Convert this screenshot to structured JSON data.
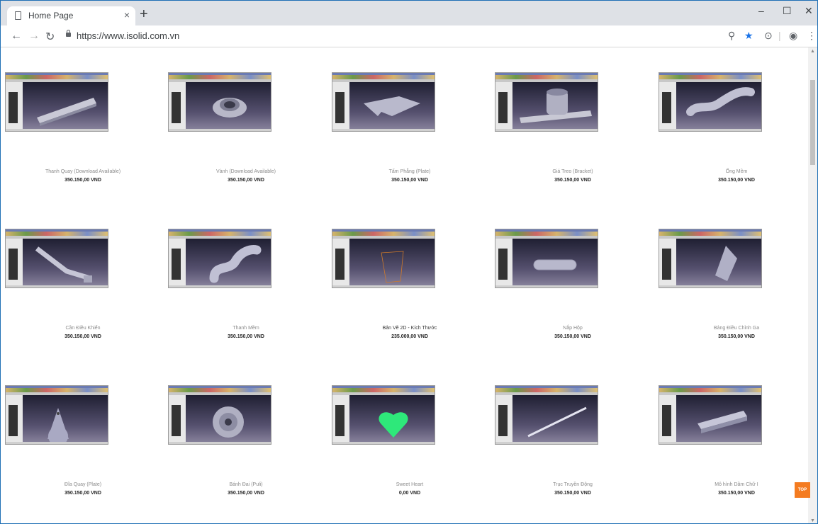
{
  "browser": {
    "tab_title": "Home Page",
    "tab_close": "×",
    "new_tab": "+",
    "url": "https://www.isolid.com.vn",
    "window_controls": [
      "–",
      "☐",
      "✕"
    ]
  },
  "toolbar_icons": [
    "zoom-icon",
    "bookmark-star-icon",
    "extension-icon",
    "profile-icon",
    "menu-icon"
  ],
  "colors": {
    "accent": "#1a73e8",
    "top_button": "#f47b20",
    "tab_strip": "#dee1e6"
  },
  "products": [
    {
      "name": "Thanh Quay (Download Available)",
      "price": "350.150,00 VND"
    },
    {
      "name": "Vành (Download Available)",
      "price": "350.150,00 VND"
    },
    {
      "name": "Tấm Phẳng (Plate)",
      "price": "350.150,00 VND"
    },
    {
      "name": "Giá Treo (Bracket)",
      "price": "350.150,00 VND"
    },
    {
      "name": "Ống Mềm",
      "price": "350.150,00 VND"
    },
    {
      "name": "Cần Điều Khiển",
      "price": "350.150,00 VND"
    },
    {
      "name": "Thanh Mềm",
      "price": "350.150,00 VND"
    },
    {
      "name": "Bản Vẽ 2D - Kích Thước",
      "price": "235.000,00 VND"
    },
    {
      "name": "Nắp Hộp",
      "price": "350.150,00 VND"
    },
    {
      "name": "Bảng Điều Chỉnh Ga",
      "price": "350.150,00 VND"
    },
    {
      "name": "Đĩa Quay (Plate)",
      "price": "350.150,00 VND"
    },
    {
      "name": "Bánh Đai (Puli)",
      "price": "350.150,00 VND"
    },
    {
      "name": "Sweet Heart",
      "price": "0,00 VND"
    },
    {
      "name": "Trục Truyền Động",
      "price": "350.150,00 VND"
    },
    {
      "name": "Mô hình Dầm Chữ I",
      "price": "350.150,00 VND"
    }
  ],
  "top_button": "TOP"
}
